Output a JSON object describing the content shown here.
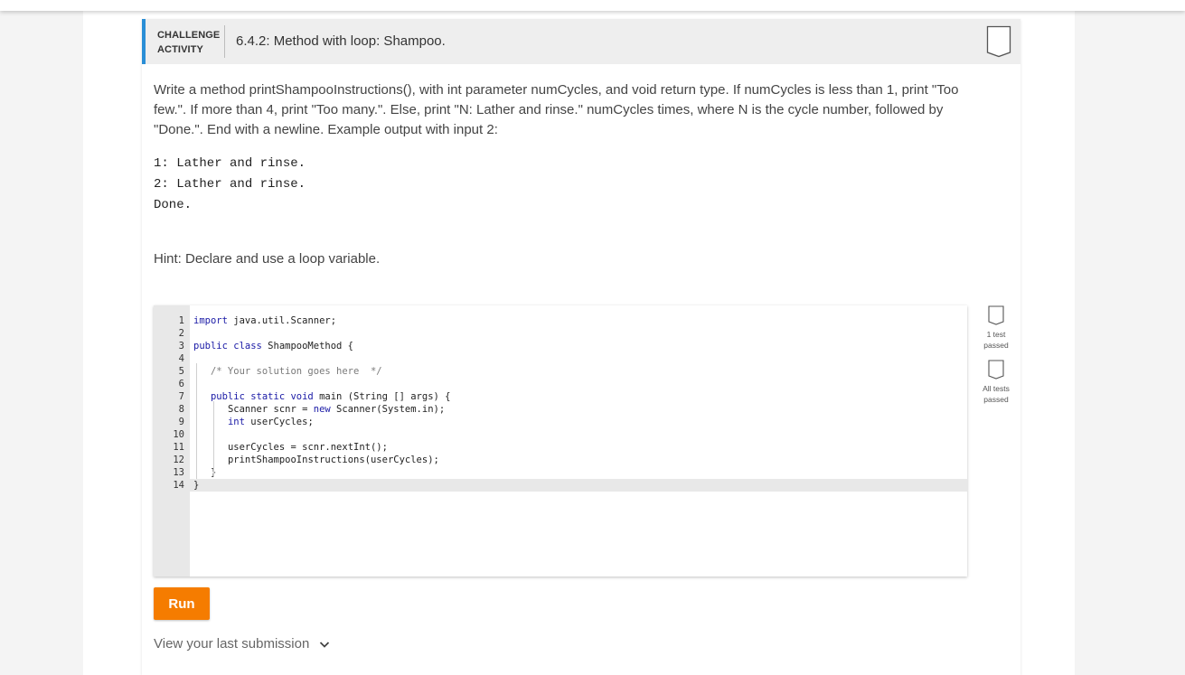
{
  "header": {
    "challenge_line1": "CHALLENGE",
    "challenge_line2": "ACTIVITY",
    "title": "6.4.2: Method with loop: Shampoo."
  },
  "instructions": "Write a method printShampooInstructions(), with int parameter numCycles, and void return type. If numCycles is less than 1, print \"Too few.\". If more than 4, print \"Too many.\". Else, print \"N: Lather and rinse.\" numCycles times, where N is the cycle number, followed by \"Done.\". End with a newline. Example output with input 2:",
  "example_output": [
    "1: Lather and rinse.",
    "2: Lather and rinse.",
    "Done."
  ],
  "hint": "Hint: Declare and use a loop variable.",
  "editor": {
    "line_numbers": [
      "1",
      "2",
      "3",
      "4",
      "5",
      "6",
      "7",
      "8",
      "9",
      "10",
      "11",
      "12",
      "13",
      "14"
    ],
    "lines": [
      {
        "kw": "import",
        "rest": " java.util.Scanner;"
      },
      {
        "kw": "",
        "rest": ""
      },
      {
        "kw": "public class",
        "rest": " ShampooMethod {"
      },
      {
        "kw": "",
        "rest": ""
      },
      {
        "indent": "   ",
        "comment": "/* Your solution goes here  */"
      },
      {
        "kw": "",
        "rest": ""
      },
      {
        "indent": "   ",
        "kw": "public static void",
        "rest": " main (String [] args) {"
      },
      {
        "indent": "      ",
        "kw": "",
        "rest": "Scanner scnr = ",
        "kw2": "new",
        "rest2": " Scanner(System.in);"
      },
      {
        "indent": "      ",
        "kw": "int",
        "rest": " userCycles;"
      },
      {
        "kw": "",
        "rest": ""
      },
      {
        "indent": "      ",
        "kw": "",
        "rest": "userCycles = scnr.nextInt();"
      },
      {
        "indent": "      ",
        "kw": "",
        "rest": "printShampooInstructions(userCycles);"
      },
      {
        "indent": "   ",
        "kw": "",
        "rest": "}"
      },
      {
        "kw": "",
        "rest": "}"
      }
    ]
  },
  "tests": {
    "first_label_1": "1 test",
    "first_label_2": "passed",
    "second_label_1": "All tests",
    "second_label_2": "passed"
  },
  "run_label": "Run",
  "last_submission_label": "View your last submission",
  "colors": {
    "accent_blue": "#2a8ed6",
    "run_orange": "#f57c00"
  },
  "icons": {
    "completion_badge": "shield-outline-icon",
    "expand": "chevron-down-icon"
  }
}
